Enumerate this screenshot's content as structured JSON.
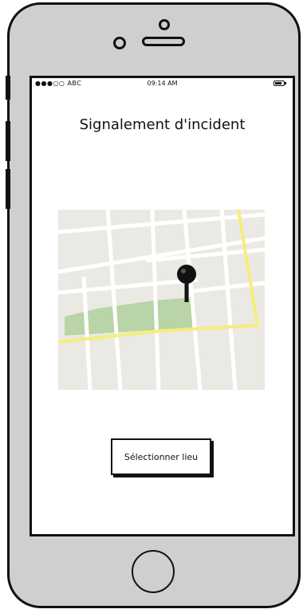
{
  "status_bar": {
    "carrier": "●●●○○ ABC",
    "time": "09:14 AM",
    "battery_icon": "battery-icon"
  },
  "screen": {
    "title": "Signalement d'incident"
  },
  "map": {
    "icon": "location-pin-icon",
    "colors": {
      "background": "#ebe9e4",
      "roads": "#ffffff",
      "highway": "#f5ee7a",
      "park": "#b9d4a6",
      "pin": "#111111"
    }
  },
  "actions": {
    "select_place_label": "Sélectionner lieu"
  },
  "device": {
    "home_button_icon": "home-button-icon"
  }
}
